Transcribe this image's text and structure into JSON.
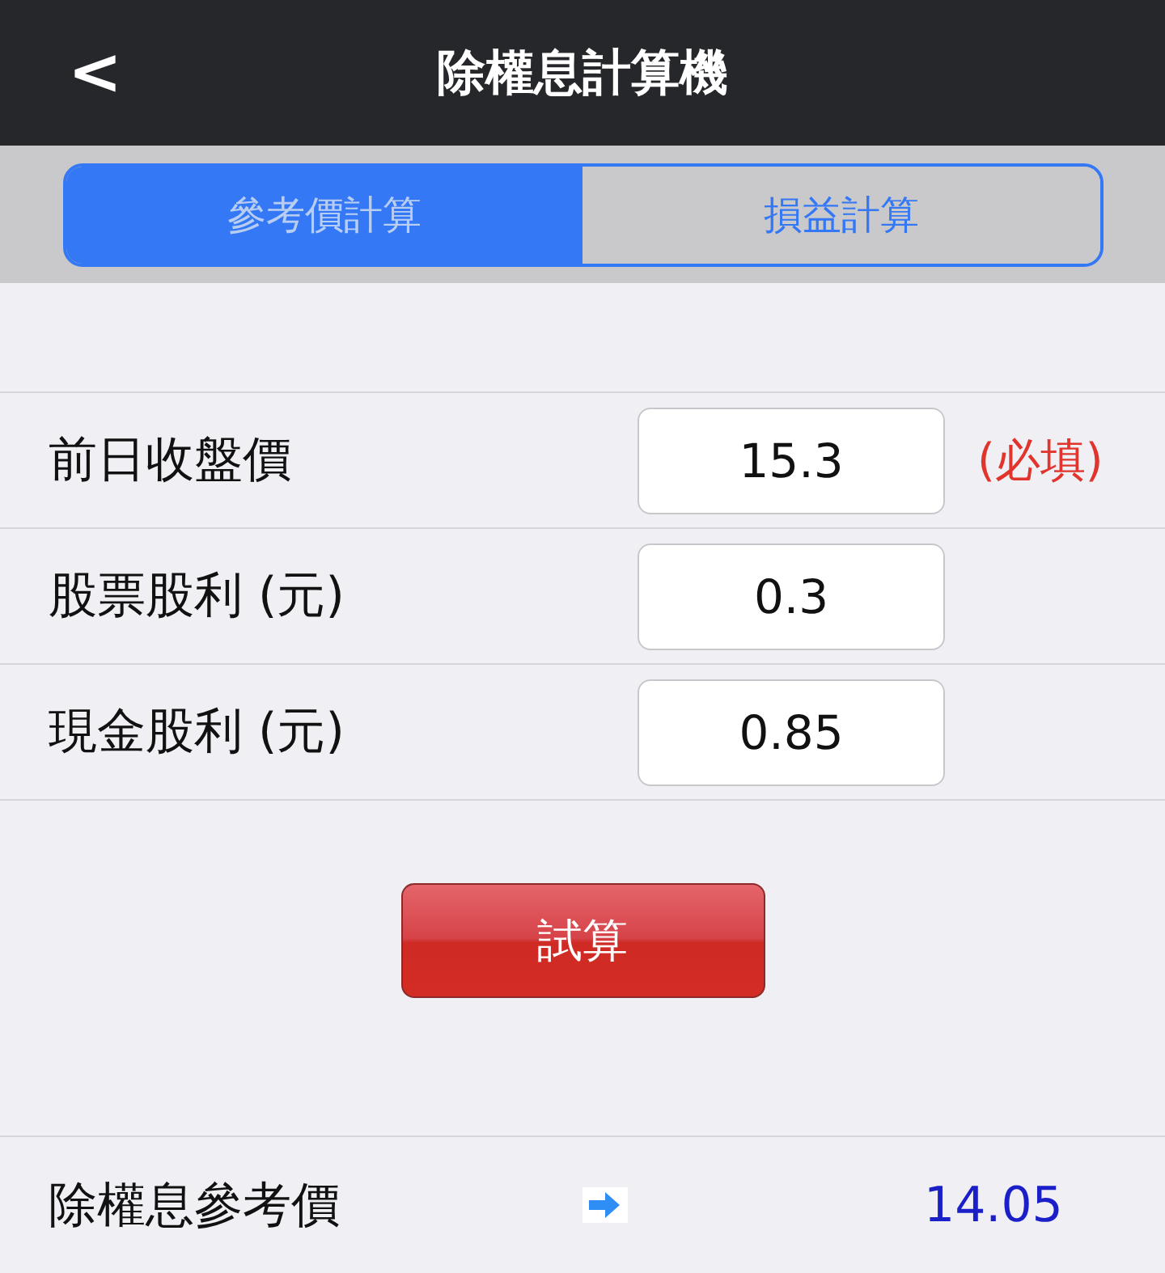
{
  "header": {
    "back": "<",
    "title": "除權息計算機"
  },
  "tabs": [
    {
      "label": "參考價計算",
      "selected": true
    },
    {
      "label": "損益計算",
      "selected": false
    }
  ],
  "fields": [
    {
      "label": "前日收盤價",
      "value": "15.3",
      "note": "(必填)"
    },
    {
      "label": "股票股利 (元)",
      "value": "0.3"
    },
    {
      "label": "現金股利 (元)",
      "value": "0.85"
    }
  ],
  "button": "試算",
  "result": {
    "label": "除權息參考價",
    "value": "14.05"
  }
}
